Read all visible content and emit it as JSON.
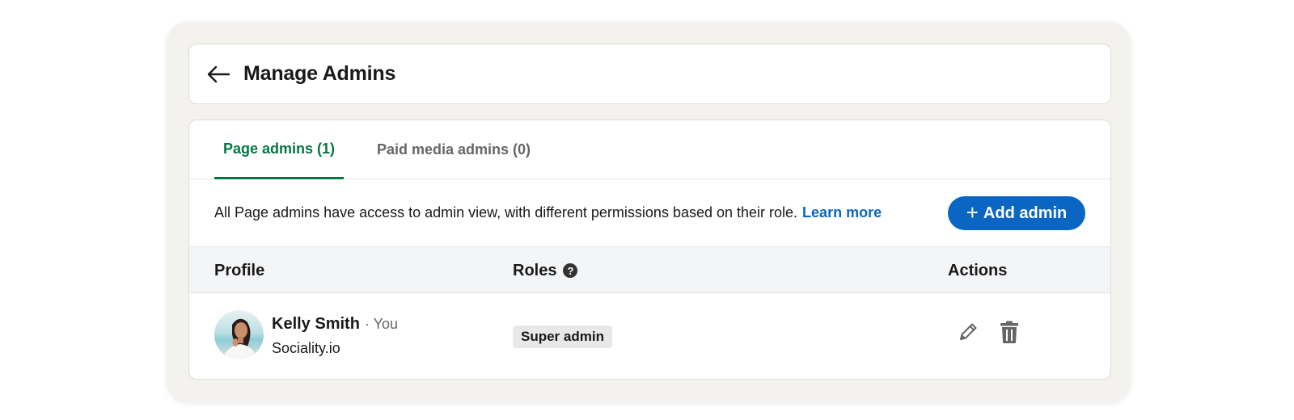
{
  "header": {
    "title": "Manage Admins",
    "back_icon": "arrow-left-icon"
  },
  "tabs": [
    {
      "label": "Page admins (1)",
      "active": true
    },
    {
      "label": "Paid media admins (0)",
      "active": false
    }
  ],
  "info": {
    "text": "All Page admins have access to admin view, with different permissions based on their role.",
    "learn_more": "Learn more"
  },
  "add_button": {
    "icon": "plus-icon",
    "label": "Add admin"
  },
  "table": {
    "columns": {
      "profile": "Profile",
      "roles": "Roles",
      "actions": "Actions"
    },
    "help_icon": "?",
    "rows": [
      {
        "name": "Kelly Smith",
        "you_label": "· You",
        "company": "Sociality.io",
        "role": "Super admin",
        "actions": [
          "pencil-icon",
          "trash-icon"
        ]
      }
    ]
  },
  "colors": {
    "brand_blue": "#0a66c2",
    "active_tab_green": "#057642",
    "page_bg": "#f3f2ef"
  }
}
